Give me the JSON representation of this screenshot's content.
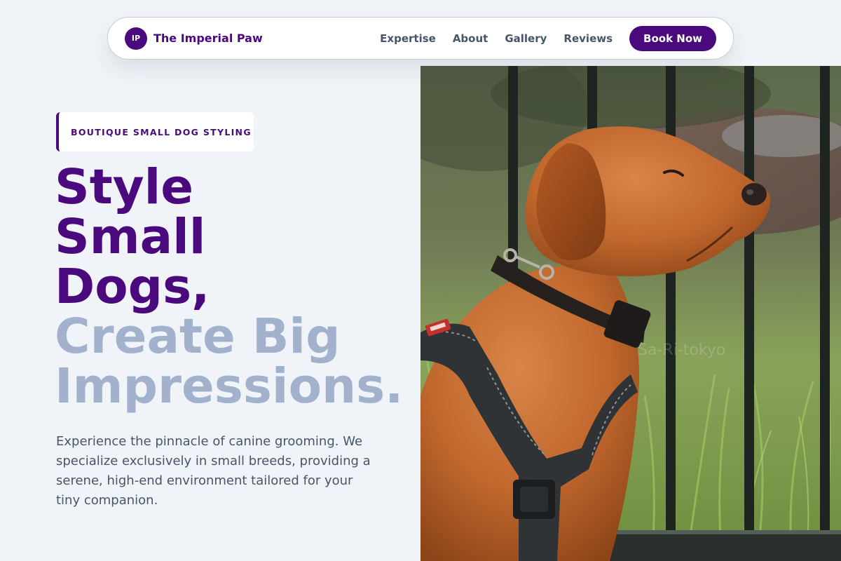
{
  "nav": {
    "logo_initials": "IP",
    "brand_name": "The Imperial Paw",
    "links": [
      "Expertise",
      "About",
      "Gallery",
      "Reviews"
    ],
    "cta_label": "Book Now"
  },
  "hero": {
    "eyebrow": "BOUTIQUE SMALL DOG STYLING",
    "headline_dark": [
      "Style",
      "Small",
      "Dogs,"
    ],
    "headline_light": [
      "Create Big",
      "Impressions."
    ],
    "intro": "Experience the pinnacle of canine grooming. We specialize exclusively in small breeds, providing a serene, high-end environment tailored for your tiny companion.",
    "image_watermark": "Sa-Ri-tokyo"
  },
  "colors": {
    "brand_purple": "#4a0a7e",
    "muted_blue": "#a2b2cc",
    "page_bg": "#f0f4f8",
    "body_text": "#475569"
  }
}
